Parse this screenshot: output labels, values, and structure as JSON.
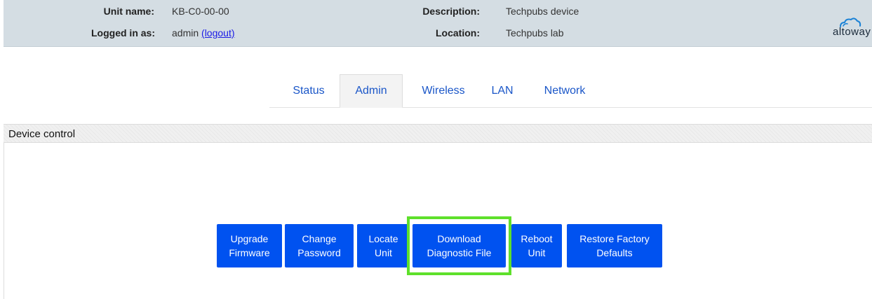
{
  "header": {
    "unit_name_label": "Unit name:",
    "unit_name_value": "KB-C0-00-00",
    "logged_in_label": "Logged in as:",
    "logged_in_user": "admin",
    "logout_link": "(logout)",
    "description_label": "Description:",
    "description_value": "Techpubs device",
    "location_label": "Location:",
    "location_value": "Techpubs lab",
    "logo_text": "altoway",
    "logo_icon": "cloud-icon"
  },
  "tabs": [
    {
      "label": "Status",
      "active": false
    },
    {
      "label": "Admin",
      "active": true
    },
    {
      "label": "Wireless",
      "active": false
    },
    {
      "label": "LAN",
      "active": false
    },
    {
      "label": "Network",
      "active": false
    }
  ],
  "section": {
    "title": "Device control"
  },
  "buttons": [
    {
      "line1": "Upgrade",
      "line2": "Firmware"
    },
    {
      "line1": "Change",
      "line2": "Password"
    },
    {
      "line1": "Locate",
      "line2": "Unit"
    },
    {
      "line1": "Download",
      "line2": "Diagnostic File",
      "highlighted": true
    },
    {
      "line1": "Reboot",
      "line2": "Unit"
    },
    {
      "line1": "Restore Factory",
      "line2": "Defaults"
    }
  ],
  "colors": {
    "header_bg": "#d4dde3",
    "tab_text": "#1a56c8",
    "button_bg": "#0052f0",
    "highlight": "#5ee02b",
    "link": "#1a1ae6"
  }
}
